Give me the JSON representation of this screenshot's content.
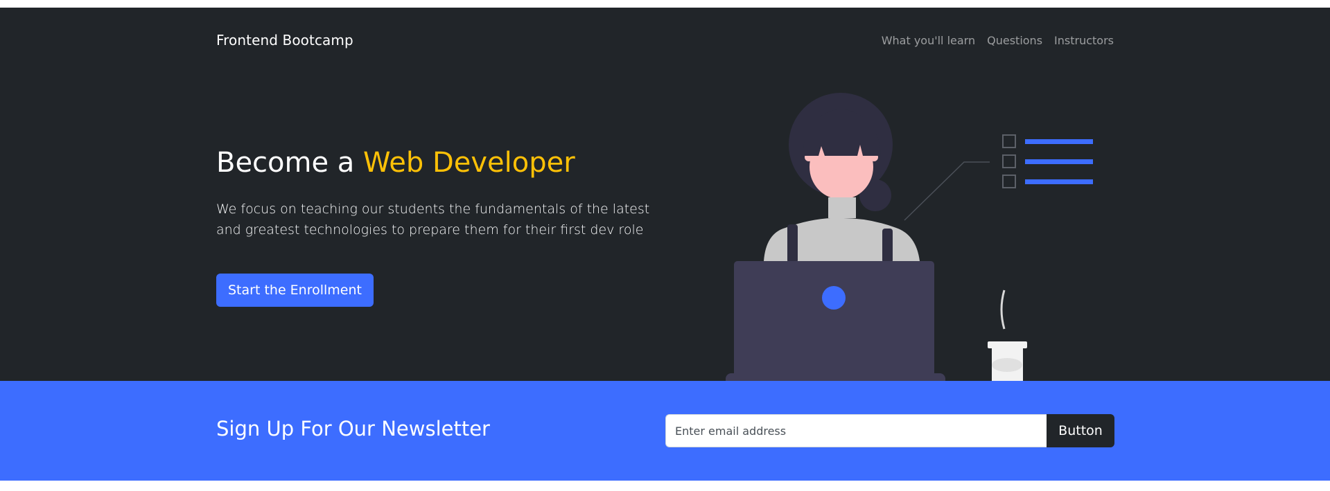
{
  "navbar": {
    "brand": "Frontend Bootcamp",
    "links": [
      "What you'll learn",
      "Questions",
      "Instructors"
    ]
  },
  "hero": {
    "title_prefix": "Become a ",
    "title_accent": "Web Developer",
    "lead": "We focus on teaching our students the fundamentals of the latest and greatest technologies to prepare them for their first dev role",
    "cta_label": "Start the Enrollment"
  },
  "newsletter": {
    "title": "Sign Up For Our Newsletter",
    "email_placeholder": "Enter email address",
    "button_label": "Button"
  },
  "illustration": {
    "name": "woman-at-laptop-illustration",
    "checklist_items": 3
  },
  "colors": {
    "dark_bg": "#212529",
    "primary": "#3d6dff",
    "accent": "#ffc107"
  }
}
